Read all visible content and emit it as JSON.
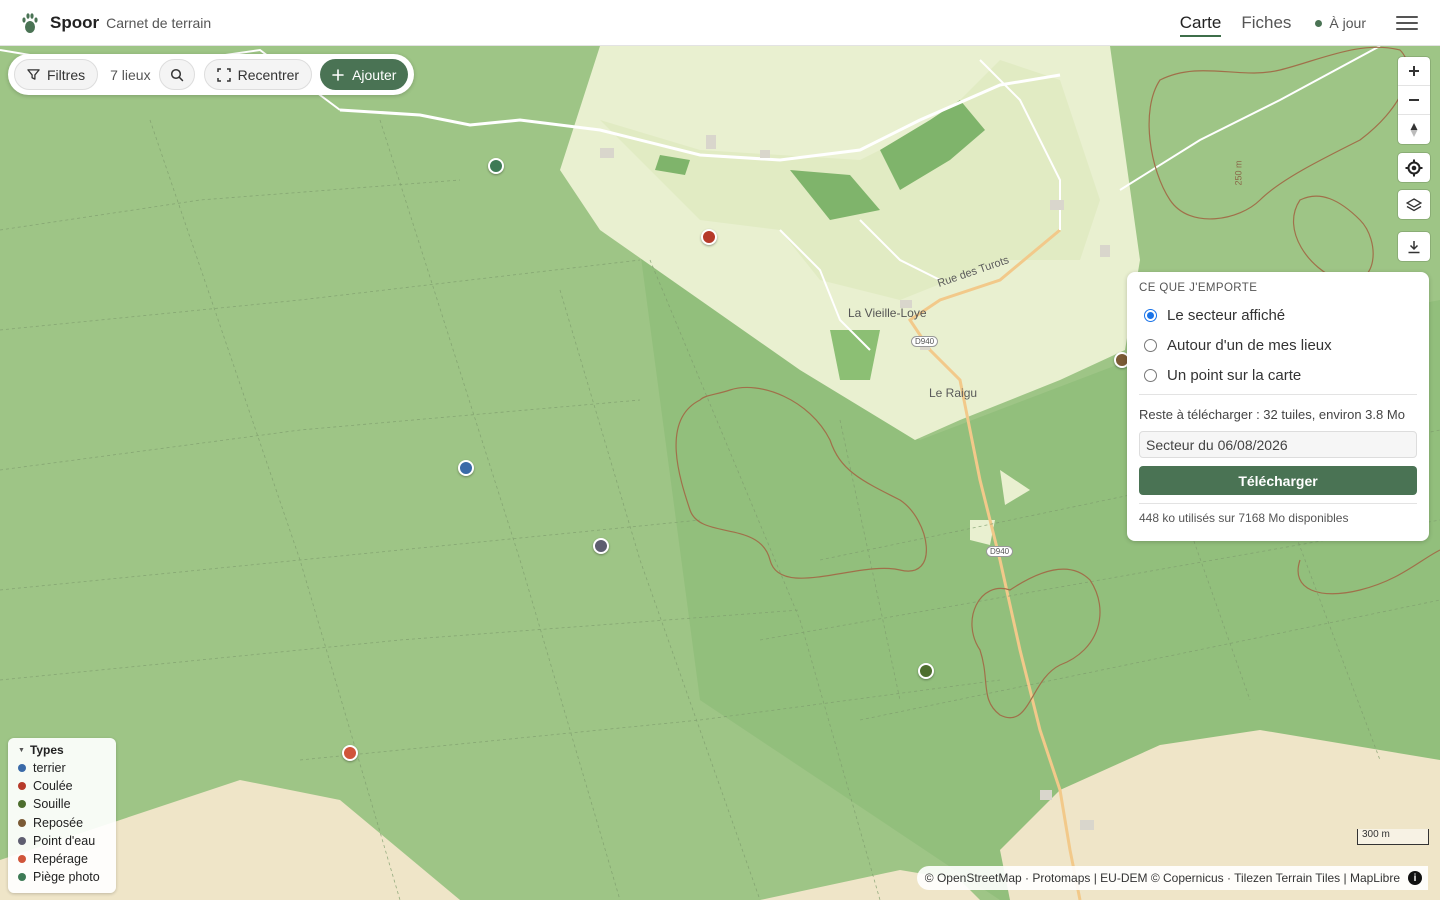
{
  "header": {
    "app_name": "Spoor",
    "app_subtitle": "Carnet de terrain",
    "tabs": [
      {
        "label": "Carte",
        "active": true
      },
      {
        "label": "Fiches",
        "active": false
      }
    ],
    "sync_status": "À jour"
  },
  "toolbar": {
    "filters_label": "Filtres",
    "place_count": "7 lieux",
    "recenter_label": "Recentrer",
    "add_label": "Ajouter"
  },
  "export_panel": {
    "title": "CE QUE J'EMPORTE",
    "options": [
      {
        "label": "Le secteur affiché",
        "checked": true
      },
      {
        "label": "Autour d'un de mes lieux",
        "checked": false
      },
      {
        "label": "Un point sur la carte",
        "checked": false
      }
    ],
    "remaining": "Reste à télécharger : 32 tuiles, environ 3.8 Mo",
    "name_value": "Secteur du 06/08/2026",
    "download_label": "Télécharger",
    "storage": "448 ko utilisés sur 7168 Mo disponibles"
  },
  "legend": {
    "title": "Types",
    "items": [
      {
        "label": "terrier",
        "color": "#3a6aa8"
      },
      {
        "label": "Coulée",
        "color": "#b63a2a"
      },
      {
        "label": "Souille",
        "color": "#4d6e2e"
      },
      {
        "label": "Reposée",
        "color": "#7a5a35"
      },
      {
        "label": "Point d'eau",
        "color": "#5e5e70"
      },
      {
        "label": "Repérage",
        "color": "#d0553a"
      },
      {
        "label": "Piège photo",
        "color": "#3d7a55"
      }
    ]
  },
  "map": {
    "labels": {
      "village1": "La Vieille-Loye",
      "village2": "Le Raigu",
      "street": "Rue des Turots",
      "road1": "D940",
      "road2": "D940",
      "contour": "250 m"
    },
    "markers": [
      {
        "type": "Piège photo",
        "color": "#3d7a55"
      },
      {
        "type": "Coulée",
        "color": "#b63a2a"
      },
      {
        "type": "terrier",
        "color": "#3a6aa8"
      },
      {
        "type": "Point d'eau",
        "color": "#5e5e70"
      },
      {
        "type": "Souille",
        "color": "#4d6e2e"
      },
      {
        "type": "Repérage",
        "color": "#d0553a"
      },
      {
        "type": "Reposée",
        "color": "#7a5a35"
      }
    ],
    "scale": "300 m",
    "attribution": "© OpenStreetMap · Protomaps | EU-DEM © Copernicus · Tilezen Terrain Tiles | MapLibre"
  }
}
